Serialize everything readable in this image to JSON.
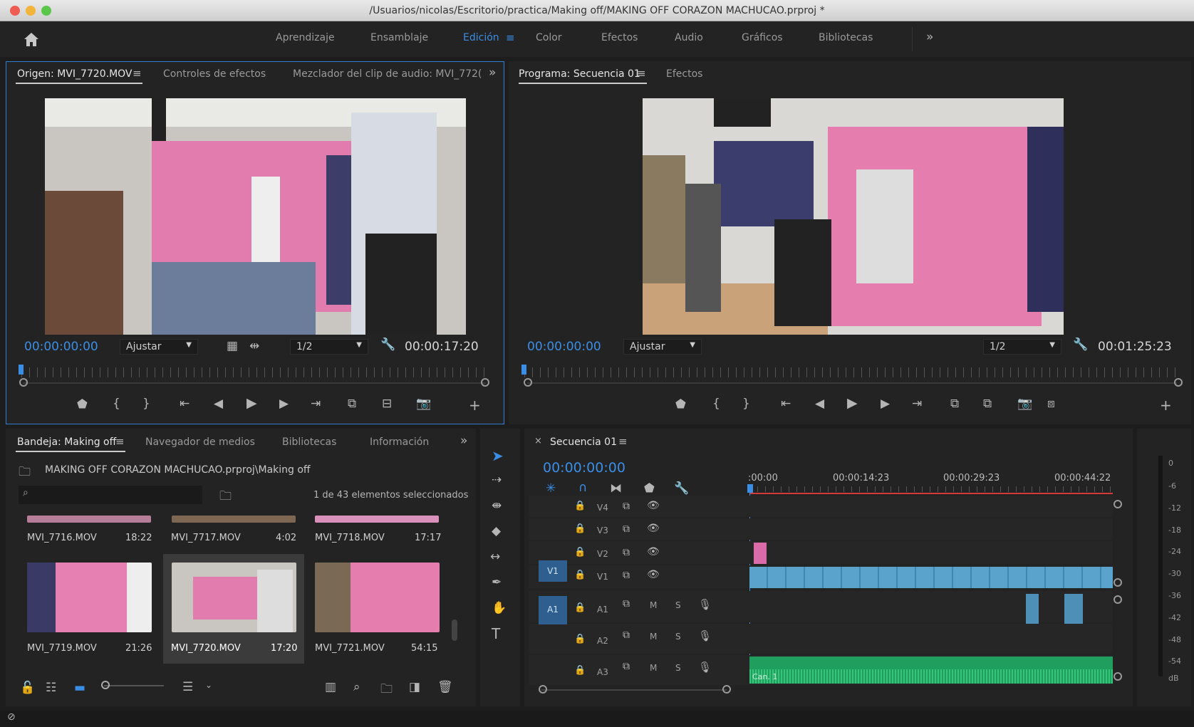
{
  "window": {
    "title": "/Usuarios/nicolas/Escritorio/practica/Making off/MAKING OFF CORAZON MACHUCAO.prproj *"
  },
  "workspaces": [
    "Aprendizaje",
    "Ensamblaje",
    "Edición",
    "Color",
    "Efectos",
    "Audio",
    "Gráficos",
    "Bibliotecas"
  ],
  "source": {
    "tabs": [
      "Origen: MVI_7720.MOV",
      "Controles de efectos",
      "Mezclador del clip de audio: MVI_772("
    ],
    "timecode": "00:00:00:00",
    "fit": "Ajustar",
    "resolution": "1/2",
    "duration": "00:00:17:20"
  },
  "program": {
    "tabs": [
      "Programa: Secuencia 01",
      "Efectos"
    ],
    "timecode": "00:00:00:00",
    "fit": "Ajustar",
    "resolution": "1/2",
    "duration": "00:01:25:23"
  },
  "project": {
    "tabs": [
      "Bandeja: Making off",
      "Navegador de medios",
      "Bibliotecas",
      "Información"
    ],
    "path": "MAKING OFF CORAZON MACHUCAO.prproj\\Making off",
    "count": "1 de 43 elementos seleccionados",
    "items": [
      {
        "name": "MVI_7716.MOV",
        "dur": "18:22"
      },
      {
        "name": "MVI_7717.MOV",
        "dur": "4:02"
      },
      {
        "name": "MVI_7718.MOV",
        "dur": "17:17"
      },
      {
        "name": "MVI_7719.MOV",
        "dur": "21:26"
      },
      {
        "name": "MVI_7720.MOV",
        "dur": "17:20"
      },
      {
        "name": "MVI_7721.MOV",
        "dur": "54:15"
      }
    ]
  },
  "timeline": {
    "tab": "Secuencia 01",
    "timecode": "00:00:00:00",
    "ruler": [
      ":00:00",
      "00:00:14:23",
      "00:00:29:23",
      "00:00:44:22"
    ],
    "video_tracks": [
      "V4",
      "V3",
      "V2",
      "V1"
    ],
    "audio_tracks": [
      "A1",
      "A2",
      "A3"
    ],
    "v1_target": "V1",
    "a1_target": "A1",
    "mute": "M",
    "solo": "S",
    "audio_clip_label": "Can. 1"
  },
  "meter": {
    "labels": [
      "0",
      "-6",
      "-12",
      "-18",
      "-24",
      "-30",
      "-36",
      "-42",
      "-48",
      "-54",
      "dB"
    ]
  },
  "colors": {
    "accent": "#3a8ee6",
    "clip_video": "#5aa3cc",
    "clip_audio": "#1f9e5e",
    "pink": "#d86ba8"
  }
}
